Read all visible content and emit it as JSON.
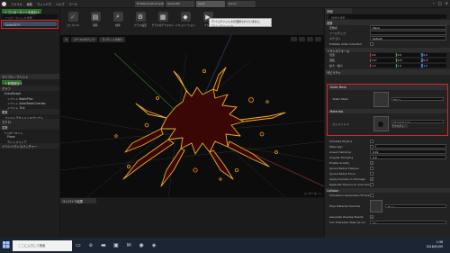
{
  "menu": [
    "ファイル",
    "編集",
    "ウィンドウ",
    "ヘルプ",
    "ツール"
  ],
  "tabs": [
    "FirstPersonExampleMap",
    "SpawnBP",
    "Splat",
    "Decal"
  ],
  "window_controls": [
    "–",
    "□",
    "✕"
  ],
  "left": {
    "add_button": "+ コンポーネントを追加 ▾",
    "search_placeholder": "コンポーネントを検索",
    "selected_item": "Splat(自己)",
    "my_blueprint_header": "マイブループリント",
    "add_new": "+ 新規追加 ▾",
    "graphs_header": "グラフ",
    "graph_items": [
      "EventGraph",
      "イベント BeginPlay",
      "イベント ActorBeginOverlap",
      "イベント Tick"
    ],
    "functions": "関数",
    "construction": "コンストラクションスクリプト",
    "macros": "マクロ",
    "variables_header": "変数",
    "components_sub": "コンポーネント",
    "var_items": [
      "Plane",
      "ライトスフィア"
    ],
    "event_dispatchers": "イベントディスパッチャー"
  },
  "toolbar": {
    "buttons": [
      {
        "label": "コンパイル",
        "icon": "✓"
      },
      {
        "label": "保存",
        "icon": "▤"
      },
      {
        "label": "検索",
        "icon": "⌕"
      },
      {
        "label": "クラス設定",
        "icon": "⚙"
      },
      {
        "label": "クラスのデフォルト",
        "icon": "▦"
      },
      {
        "label": "シミュレーション",
        "icon": "◆"
      },
      {
        "label": "プレイ",
        "icon": "▶"
      }
    ],
    "tooltip": "デバッグフィルタが選択されていません",
    "tooltip_sub": "デバッグフィルタ"
  },
  "viewport": {
    "mode": "パースペクティブ",
    "lighting": "ライティングあり",
    "footer": "コンポーネント"
  },
  "bottom": {
    "tab": "コンパイラ結果"
  },
  "details": {
    "header": "詳細",
    "search_placeholder": "詳細を検索",
    "variable_section": "変数",
    "variable_props": [
      {
        "k": "変数名",
        "v": "Plane"
      },
      {
        "k": "ツールチップ",
        "v": ""
      },
      {
        "k": "カテゴリ",
        "v": "Default"
      }
    ],
    "editable_label": "Editable when Inherited",
    "transform_section": "トランスフォーム",
    "location": {
      "k": "位置",
      "x": "0.0",
      "y": "0.0",
      "z": "0.0"
    },
    "rotation": {
      "k": "回転",
      "x": "0.0°",
      "y": "0.0°",
      "z": "0.0°"
    },
    "scale": {
      "k": "拡大・縮小",
      "x": "1.0",
      "y": "1.0",
      "z": "1.0"
    },
    "mobility_section": "モビリティ",
    "static_mesh_section": "Static Mesh",
    "static_mesh_label": "Static Mesh",
    "static_mesh_value": "Plane",
    "materials_section": "Materials",
    "element_label": "エレメント 0",
    "material_value": "M_Splat_Inst",
    "material_sub": "テクスチャ",
    "physics_props": [
      "Simulate Physics",
      "Mass (kg)",
      "Linear Damping",
      "Angular Damping",
      "Enable Gravity",
      "Ignore Radial Impulse",
      "Ignore Radial Force",
      "Apply Impulse on Damage",
      "Replicate Physics to Autonomous Proxy"
    ],
    "physics_values": [
      "",
      "",
      "0.01",
      "0.0",
      "✓",
      "",
      "",
      "✓",
      ""
    ],
    "collision_section": "Collision",
    "collision_props": [
      "Simulation Generates Hit Events",
      "Phys Material Override",
      "Generate Overlap Events",
      "Can Character Step Up On"
    ],
    "collision_values": [
      "",
      "None",
      "✓",
      "Yes"
    ]
  },
  "taskbar": {
    "search": "ここに入力して検索",
    "icons": [
      "window-icon",
      "task-view-icon",
      "edge-icon",
      "folder-icon",
      "store-icon",
      "mail-icon",
      "unreal-icon",
      "app-icon"
    ],
    "time": "1:38",
    "date": "2018/01/05"
  },
  "colors": {
    "highlight": "#d8262b",
    "splat": "#e8b02a",
    "splat_fill": "#3b0606"
  }
}
